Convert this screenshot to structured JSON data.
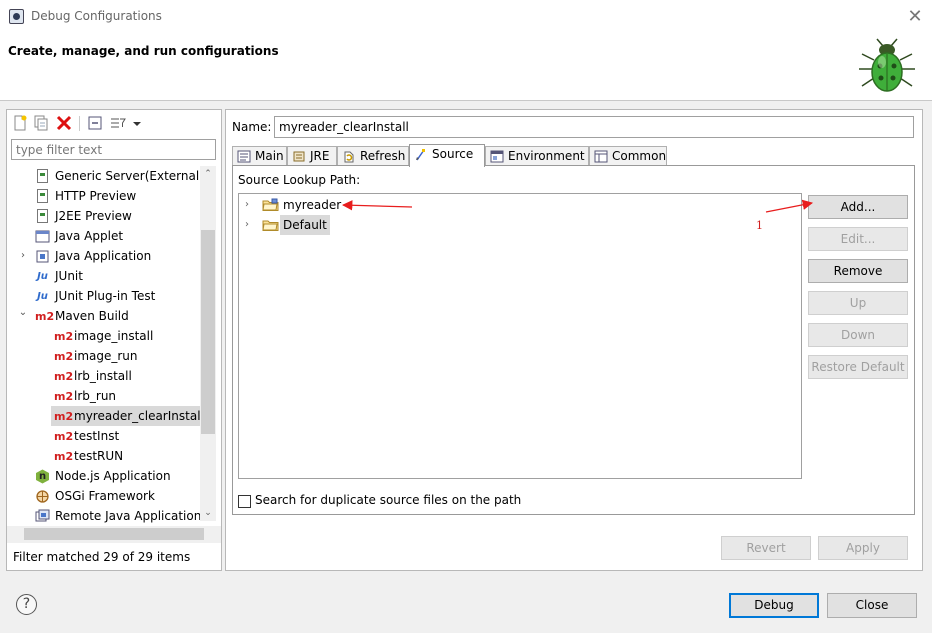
{
  "window": {
    "title": "Debug Configurations",
    "close_glyph": "✕",
    "header": "Create, manage, and run configurations"
  },
  "left": {
    "toolbar_icons": [
      "new-configuration-icon",
      "duplicate-icon",
      "delete-icon",
      "collapse-all-icon",
      "filter-icon",
      "dropdown-arrow-icon"
    ],
    "filter_placeholder": "type filter text",
    "tree": [
      {
        "label": "Generic Server(External L",
        "icon": "file-icon",
        "level": 1,
        "expandable": false
      },
      {
        "label": "HTTP Preview",
        "icon": "file-icon",
        "level": 1,
        "expandable": false
      },
      {
        "label": "J2EE Preview",
        "icon": "file-icon",
        "level": 1,
        "expandable": false
      },
      {
        "label": "Java Applet",
        "icon": "applet-icon",
        "level": 1,
        "expandable": false
      },
      {
        "label": "Java Application",
        "icon": "java-app-icon",
        "level": 1,
        "expandable": true,
        "expanded": false
      },
      {
        "label": "JUnit",
        "icon": "junit-icon",
        "level": 1,
        "expandable": false
      },
      {
        "label": "JUnit Plug-in Test",
        "icon": "junit-plugin-icon",
        "level": 1,
        "expandable": false
      },
      {
        "label": "Maven Build",
        "icon": "m2-icon",
        "level": 1,
        "expandable": true,
        "expanded": true
      },
      {
        "label": "image_install",
        "icon": "m2-icon",
        "level": 2
      },
      {
        "label": "image_run",
        "icon": "m2-icon",
        "level": 2
      },
      {
        "label": "lrb_install",
        "icon": "m2-icon",
        "level": 2
      },
      {
        "label": "lrb_run",
        "icon": "m2-icon",
        "level": 2
      },
      {
        "label": "myreader_clearInstall",
        "icon": "m2-icon",
        "level": 2,
        "selected": true
      },
      {
        "label": "testInst",
        "icon": "m2-icon",
        "level": 2
      },
      {
        "label": "testRUN",
        "icon": "m2-icon",
        "level": 2
      },
      {
        "label": "Node.js Application",
        "icon": "nodejs-icon",
        "level": 1
      },
      {
        "label": "OSGi Framework",
        "icon": "osgi-icon",
        "level": 1
      },
      {
        "label": "Remote Java Application",
        "icon": "remote-java-icon",
        "level": 1
      }
    ],
    "m2_text": "m2",
    "ju_text": "Ju",
    "n_text": "n",
    "status": "Filter matched 29 of 29 items"
  },
  "right": {
    "name_label": "Name:",
    "name_value": "myreader_clearInstall",
    "tabs": [
      {
        "label": "Main",
        "icon": "main-tab-icon"
      },
      {
        "label": "JRE",
        "icon": "jre-tab-icon"
      },
      {
        "label": "Refresh",
        "icon": "refresh-tab-icon"
      },
      {
        "label": "Source",
        "icon": "source-tab-icon",
        "active": true
      },
      {
        "label": "Environment",
        "icon": "environment-tab-icon"
      },
      {
        "label": "Common",
        "icon": "common-tab-icon"
      }
    ],
    "lookup_label": "Source Lookup Path:",
    "lookup_items": [
      {
        "label": "myreader",
        "icon": "project-folder-icon"
      },
      {
        "label": "Default",
        "icon": "folder-icon",
        "selected": true
      }
    ],
    "side_buttons": [
      {
        "label": "Add...",
        "enabled": true
      },
      {
        "label": "Edit...",
        "enabled": false
      },
      {
        "label": "Remove",
        "enabled": true
      },
      {
        "label": "Up",
        "enabled": false
      },
      {
        "label": "Down",
        "enabled": false
      },
      {
        "label": "Restore Default",
        "enabled": false
      }
    ],
    "annotation_number": "1",
    "dup_checkbox_label": "Search for duplicate source files on the path",
    "revert_label": "Revert",
    "apply_label": "Apply"
  },
  "footer": {
    "help_glyph": "?",
    "debug_label": "Debug",
    "close_label": "Close"
  },
  "colors": {
    "annotation_red": "#e81d1d",
    "m2_red": "#d11f1f",
    "selection": "#d9d9d9",
    "default_button_border": "#0078d7"
  }
}
